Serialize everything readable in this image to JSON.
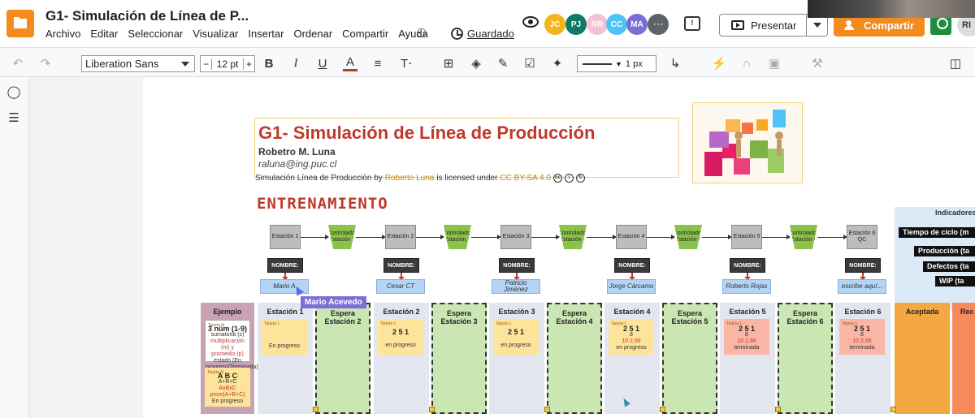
{
  "app": {
    "doc_title": "G1- Simulación de Línea de P...",
    "menu": [
      "Archivo",
      "Editar",
      "Seleccionar",
      "Visualizar",
      "Insertar",
      "Ordenar",
      "Compartir",
      "Ayuda"
    ],
    "saved_label": "Guardado",
    "present_label": "Presentar",
    "share_label": "Compartir",
    "avatars": [
      {
        "initials": "JC",
        "color": "#f2b51c"
      },
      {
        "initials": "PJ",
        "color": "#117a65"
      },
      {
        "initials": "RR",
        "color": "#f4c2d6"
      },
      {
        "initials": "CC",
        "color": "#4fc3f7"
      },
      {
        "initials": "MA",
        "color": "#7b6fd6"
      }
    ],
    "user_initials": "RI"
  },
  "toolbar": {
    "font": "Liberation Sans",
    "font_size": "12 pt",
    "line_width": "1 px",
    "minus": "−",
    "plus": "+"
  },
  "header": {
    "title": "G1- Simulación de Línea de Producción",
    "author": "Robetro M. Luna",
    "email": "raluna@ing.puc.cl",
    "license_prefix": "Simulación Línea de Producción by",
    "license_author": "Roberto Luna",
    "license_mid": "is licensed under",
    "license_link": "CC BY-SA 4.0"
  },
  "section_title": "ENTRENAMIENTO",
  "flow": {
    "stations": [
      "Estación 1",
      "Estación 2",
      "Estación 3",
      "Estación 4",
      "Estación 5",
      "Estación 6 QC"
    ],
    "controls": [
      "Controlador Estación 2",
      "Controlador Estación 3",
      "Controlador Estación 4",
      "Controlador Estación 5",
      "Controlador Estación 6"
    ],
    "name_label": "NOMBRE:",
    "names": [
      "Mario A",
      "Cesar CT",
      "Patricio Jiménez",
      "Jorge Cárcamo",
      "Roberto Rojas",
      "escribe aquí..."
    ]
  },
  "indicators": {
    "title": "Indicadores",
    "items": [
      "Tiempo de ciclo (m",
      "Producción (ta",
      "Defectos (ta",
      "WIP (ta"
    ]
  },
  "board": {
    "example_title": "Ejemplo",
    "example_card1": {
      "tk": "Tarjeta N",
      "line1": "3 núm (1-9)",
      "line2": "sumatoria (s)",
      "line3": "multiplicación (m) y",
      "line4": "promedio (p)",
      "line5": "estado (En",
      "line6": "progreso/Terminada)"
    },
    "example_card2": {
      "tk": "Tarjeta N",
      "line1": "A B C",
      "line2": "A+B+C",
      "line3": "AxBxC",
      "line4": "prom(A+B+C)",
      "line5": "En progreso"
    },
    "columns": [
      {
        "title": "Estación 1",
        "type": "station",
        "card": {
          "tk": "Tarjeta 1",
          "value": "",
          "status": "En progreso",
          "color": "yellow"
        }
      },
      {
        "title": "Espera Estación 2",
        "type": "wait"
      },
      {
        "title": "Estación 2",
        "type": "station",
        "card": {
          "tk": "Tarjeta 1",
          "value": "2 5 1",
          "status": "en progreso",
          "color": "yellow"
        }
      },
      {
        "title": "Espera Estación 3",
        "type": "wait"
      },
      {
        "title": "Estación 3",
        "type": "station",
        "card": {
          "tk": "Tarjeta 1",
          "value": "2 5 1",
          "status": "en progreso",
          "color": "yellow"
        }
      },
      {
        "title": "Espera Estación 4",
        "type": "wait"
      },
      {
        "title": "Estación 4",
        "type": "station",
        "card": {
          "tk": "Tarjeta 1",
          "value": "2 5 1",
          "sub1": "8",
          "sub2": "10 2,66",
          "status": "en progreso",
          "color": "yellow"
        }
      },
      {
        "title": "Espera Estación 5",
        "type": "wait"
      },
      {
        "title": "Estación 5",
        "type": "station",
        "card": {
          "tk": "Tarjeta 1",
          "value": "2 5 1",
          "sub1": "8",
          "sub2": "10 2,66",
          "status": "terminada",
          "color": "pink"
        }
      },
      {
        "title": "Espera Estación 6",
        "type": "wait"
      },
      {
        "title": "Estación 6",
        "type": "station",
        "card": {
          "tk": "Tarjeta 1",
          "value": "2 5 1",
          "sub1": "8",
          "sub2": "10 2,66",
          "status": "terminada",
          "color": "pink"
        }
      }
    ],
    "accepted_title": "Aceptada",
    "rejected_title": "Rec"
  },
  "cursor_user": "Mario Acevedo"
}
